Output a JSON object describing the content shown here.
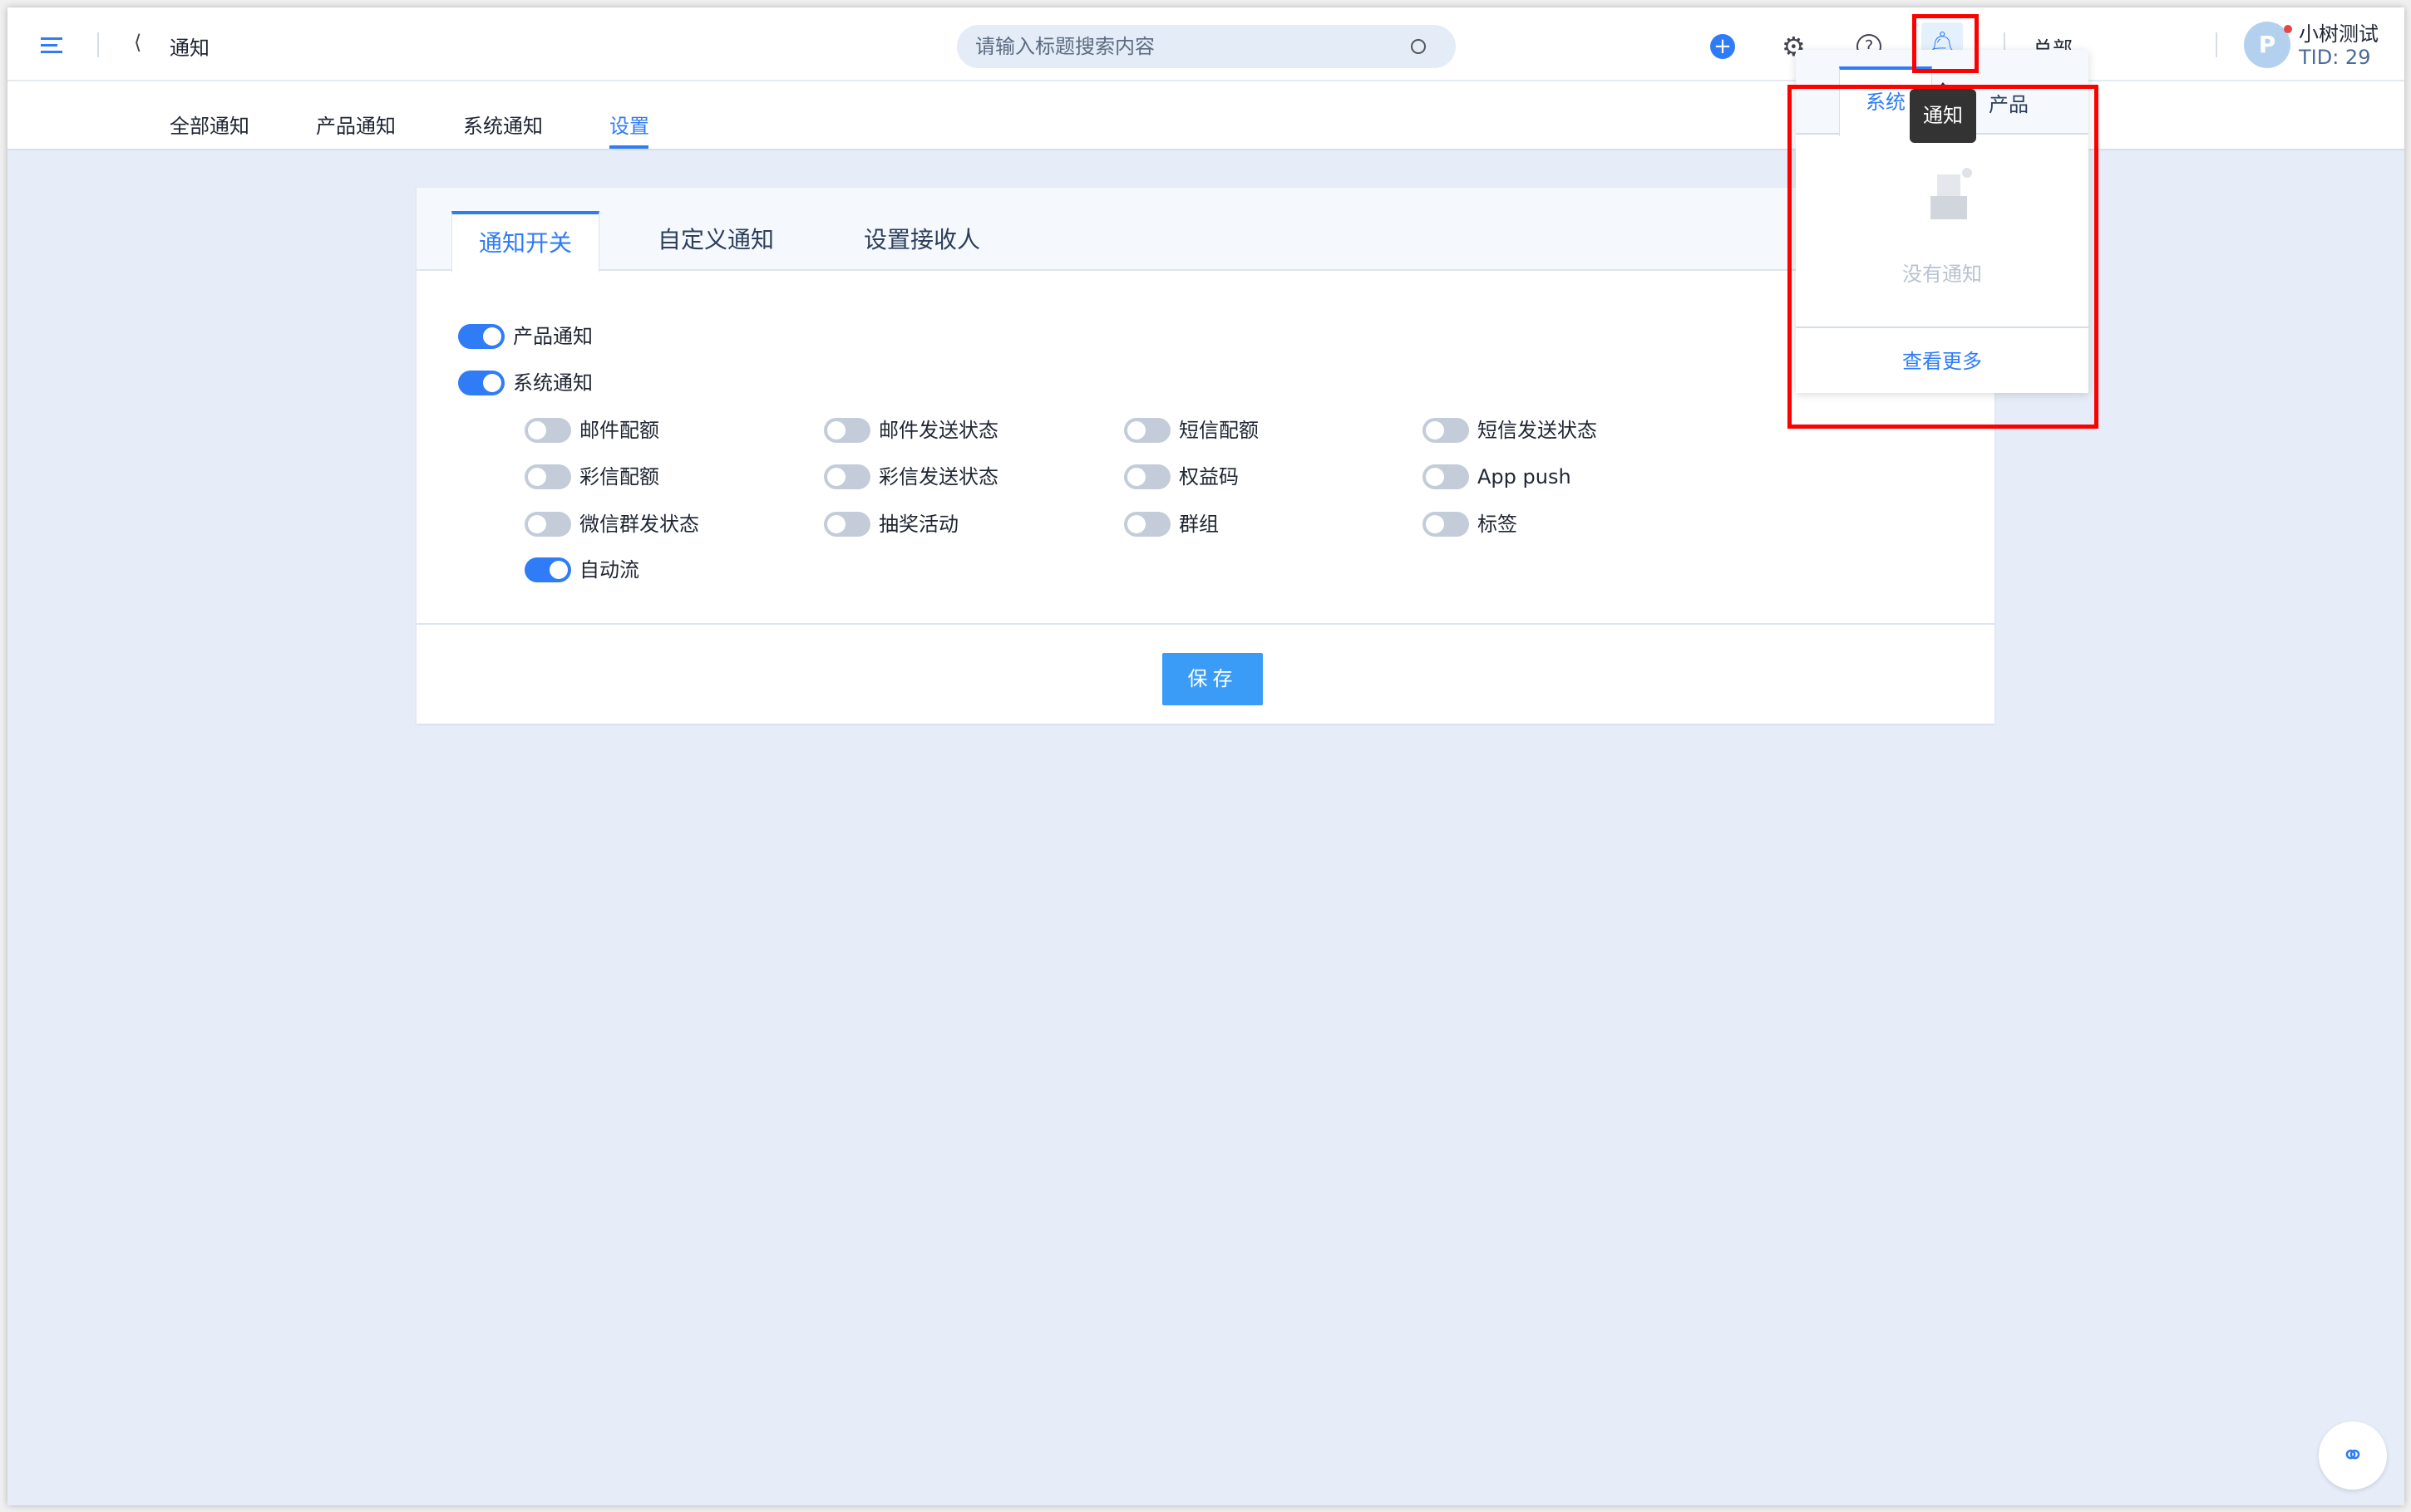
{
  "header": {
    "back_title": "通知",
    "search_placeholder": "请输入标题搜索内容",
    "org": "总部",
    "user_name": "小树测试",
    "user_tid": "TID: 29",
    "avatar_letter": "P",
    "bell_tooltip": "通知"
  },
  "subnav": [
    {
      "label": "全部通知"
    },
    {
      "label": "产品通知"
    },
    {
      "label": "系统通知"
    },
    {
      "label": "设置",
      "active": true
    }
  ],
  "card": {
    "tabs": [
      {
        "label": "通知开关",
        "active": true
      },
      {
        "label": "自定义通知"
      },
      {
        "label": "设置接收人"
      }
    ],
    "top_toggles": [
      {
        "label": "产品通知",
        "on": true
      },
      {
        "label": "系统通知",
        "on": true
      }
    ],
    "sub_toggles": [
      {
        "label": "邮件配额",
        "on": false
      },
      {
        "label": "邮件发送状态",
        "on": false
      },
      {
        "label": "短信配额",
        "on": false
      },
      {
        "label": "短信发送状态",
        "on": false
      },
      {
        "label": "彩信配额",
        "on": false
      },
      {
        "label": "彩信发送状态",
        "on": false
      },
      {
        "label": "权益码",
        "on": false
      },
      {
        "label": "App push",
        "on": false
      },
      {
        "label": "微信群发状态",
        "on": false
      },
      {
        "label": "抽奖活动",
        "on": false
      },
      {
        "label": "群组",
        "on": false
      },
      {
        "label": "标签",
        "on": false
      },
      {
        "label": "自动流",
        "on": true
      }
    ],
    "save_label": "保存"
  },
  "popover": {
    "tabs": [
      {
        "label": "系统",
        "active": true
      },
      {
        "label": "产品"
      }
    ],
    "empty_text": "没有通知",
    "more_label": "查看更多"
  },
  "colors": {
    "accent": "#2f7cf6",
    "highlight": "#ff0000"
  }
}
